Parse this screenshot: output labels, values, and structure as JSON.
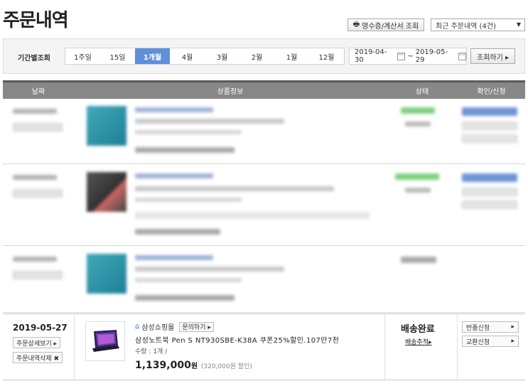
{
  "page_title": "주문내역",
  "header": {
    "receipt_button": "영수증/계산서 조회",
    "recent_select": "최근 주문내역 (4건)"
  },
  "period": {
    "label": "기간별조회",
    "tabs": [
      "1주일",
      "15일",
      "1개월",
      "4월",
      "3월",
      "2월",
      "1월",
      "12월"
    ],
    "active_tab": "1개월",
    "date_from": "2019-04-30",
    "date_to": "2019-05-29",
    "separator": "~",
    "search_button": "조회하기 ▸"
  },
  "table_header": {
    "date": "날짜",
    "product": "상품정보",
    "status": "상태",
    "action": "확인/신청"
  },
  "order": {
    "date": "2019-05-27",
    "detail_button": "주문상세보기 ▸",
    "delete_button": "주문내역삭제 ✖",
    "seller": "삼성쇼핑몰",
    "inquiry_button": "문의하기 ▸",
    "product_name": "삼성노트북 Pen S NT930SBE-K38A 쿠폰25%할인.107만7천",
    "quantity": "수량 : 1개 /",
    "price": "1,139,000",
    "price_unit": "원",
    "discount": "(320,000원 할인)",
    "status": "배송완료",
    "track_link": "배송추적▸",
    "return_button": "반품신청",
    "exchange_button": "교환신청"
  },
  "colors": {
    "accent": "#5f8fd8",
    "header_bar": "#878787",
    "seller_icon": "#2b6fd6"
  }
}
